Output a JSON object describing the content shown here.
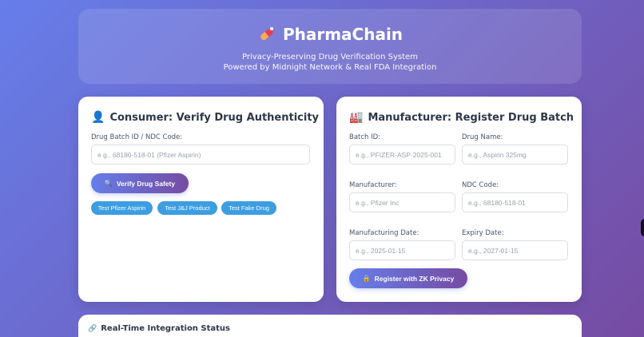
{
  "header": {
    "app_name": "PharmaChain",
    "subtitle_line1": "Privacy-Preserving Drug Verification System",
    "subtitle_line2": "Powered by Midnight Network & Real FDA Integration",
    "logo_icon": "pill-icon"
  },
  "consumer": {
    "icon": "👤",
    "title": "Consumer: Verify Drug Authenticity",
    "batch_label": "Drug Batch ID / NDC Code:",
    "batch_placeholder": "e.g., 68180-518-01 (Pfizer Aspirin)",
    "verify_icon": "🔍",
    "verify_label": "Verify Drug Safety",
    "test_buttons": [
      "Test Pfizer Aspirin",
      "Test J&J Product",
      "Test Fake Drug"
    ]
  },
  "manufacturer": {
    "icon": "🏭",
    "title": "Manufacturer: Register Drug Batch",
    "batch_id_label": "Batch ID:",
    "batch_id_placeholder": "e.g., PFIZER-ASP-2025-001",
    "drug_name_label": "Drug Name:",
    "drug_name_placeholder": "e.g., Aspirin 325mg",
    "manufacturer_label": "Manufacturer:",
    "manufacturer_placeholder": "e.g., Pfizer Inc",
    "ndc_label": "NDC Code:",
    "ndc_placeholder": "e.g., 68180-518-01",
    "mfg_date_label": "Manufacturing Date:",
    "mfg_date_placeholder": "e.g., 2025-01-15",
    "expiry_label": "Expiry Date:",
    "expiry_placeholder": "e.g., 2027-01-15",
    "register_icon": "🔒",
    "register_label": "Register with ZK Privacy"
  },
  "status": {
    "icon": "🔗",
    "title": "Real-Time Integration Status"
  },
  "colors": {
    "bg_start": "#667eea",
    "bg_end": "#764ba2",
    "test_button": "#3c9ee0",
    "pill_red": "#e53e5c"
  }
}
